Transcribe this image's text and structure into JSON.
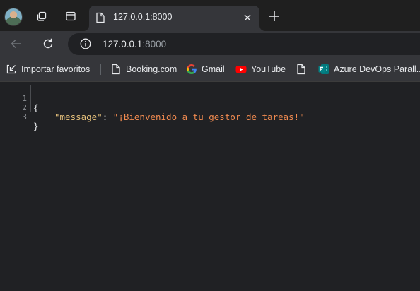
{
  "tab": {
    "title": "127.0.0.1:8000"
  },
  "omnibox": {
    "host": "127.0.0.1",
    "port": ":8000"
  },
  "bookmarks": [
    {
      "label": "Importar favoritos",
      "icon": "import-icon"
    },
    {
      "label": "Booking.com",
      "icon": "page-icon"
    },
    {
      "label": "Gmail",
      "icon": "google-icon"
    },
    {
      "label": "YouTube",
      "icon": "youtube-icon"
    },
    {
      "label": "",
      "icon": "page-icon"
    },
    {
      "label": "Azure DevOps Parall...",
      "icon": "forms-icon"
    }
  ],
  "json_view": {
    "lines": [
      {
        "number": "1",
        "open": "{"
      },
      {
        "number": "2",
        "key": "\"message\"",
        "colon": ": ",
        "value": "\"¡Bienvenido a tu gestor de tareas!\""
      },
      {
        "number": "3",
        "close": "}"
      }
    ]
  },
  "colors": {
    "key": "#e5c07b",
    "string": "#f28b50",
    "background": "#202124"
  }
}
